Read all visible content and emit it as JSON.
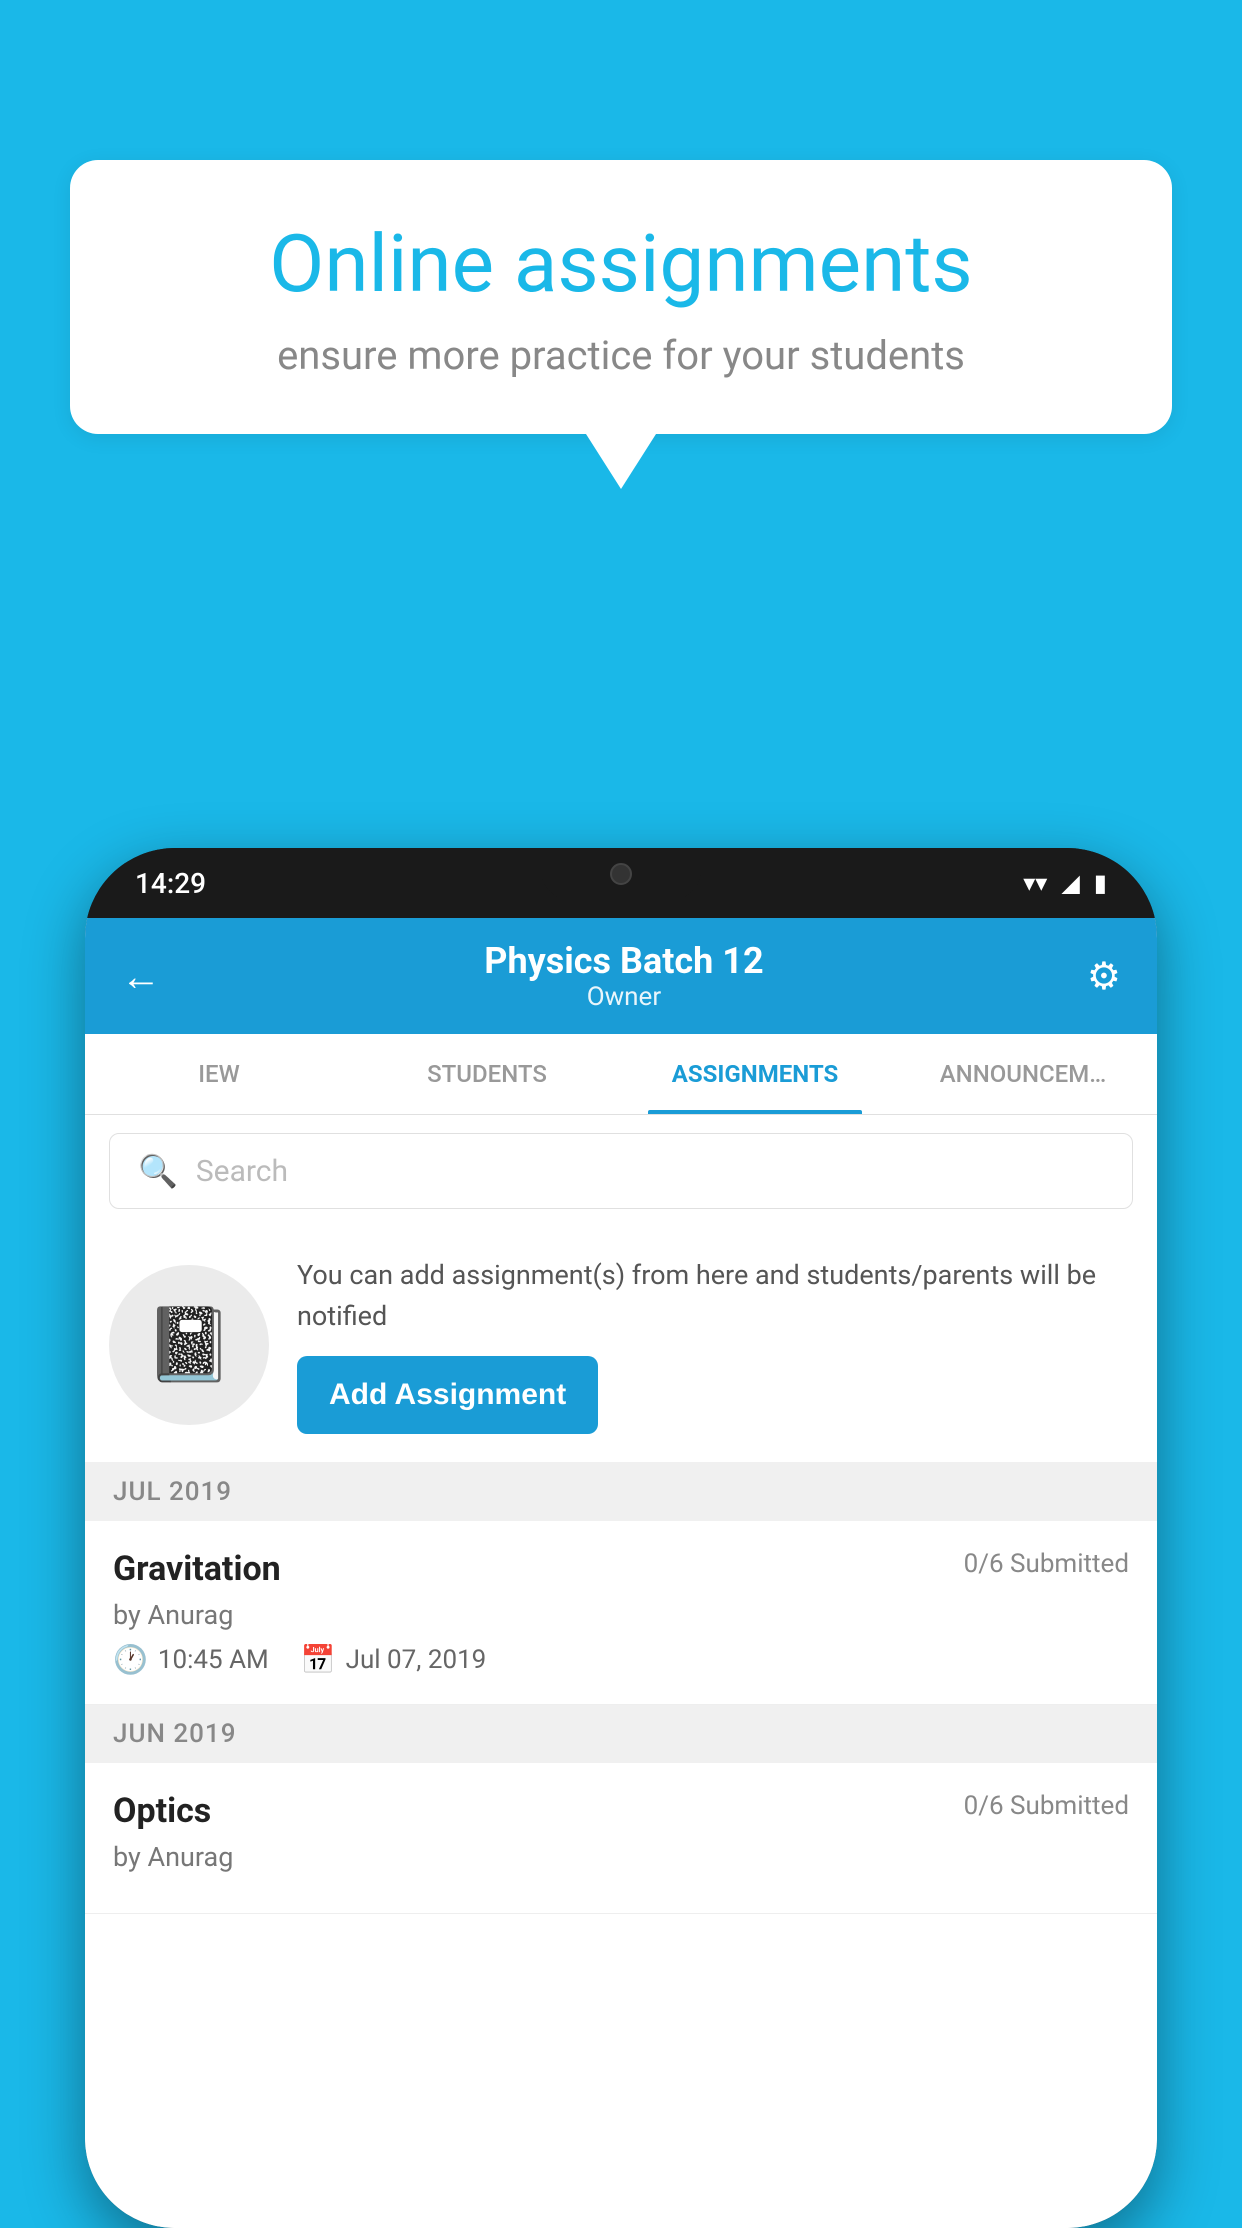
{
  "background_color": "#1ab8e8",
  "speech_bubble": {
    "title": "Online assignments",
    "subtitle": "ensure more practice for your students"
  },
  "phone": {
    "status_bar": {
      "time": "14:29",
      "wifi": "▼",
      "signal": "▲",
      "battery": "▮"
    },
    "app_bar": {
      "title": "Physics Batch 12",
      "subtitle": "Owner",
      "back_label": "←",
      "settings_label": "⚙"
    },
    "tabs": [
      {
        "label": "IEW",
        "active": false
      },
      {
        "label": "STUDENTS",
        "active": false
      },
      {
        "label": "ASSIGNMENTS",
        "active": true
      },
      {
        "label": "ANNOUNCEM…",
        "active": false
      }
    ],
    "search": {
      "placeholder": "Search"
    },
    "promo": {
      "description": "You can add assignment(s) from here and students/parents will be notified",
      "button_label": "Add Assignment"
    },
    "sections": [
      {
        "month_label": "JUL 2019",
        "assignments": [
          {
            "title": "Gravitation",
            "submitted": "0/6 Submitted",
            "by": "by Anurag",
            "time": "10:45 AM",
            "date": "Jul 07, 2019"
          }
        ]
      },
      {
        "month_label": "JUN 2019",
        "assignments": [
          {
            "title": "Optics",
            "submitted": "0/6 Submitted",
            "by": "by Anurag",
            "time": "",
            "date": ""
          }
        ]
      }
    ]
  }
}
